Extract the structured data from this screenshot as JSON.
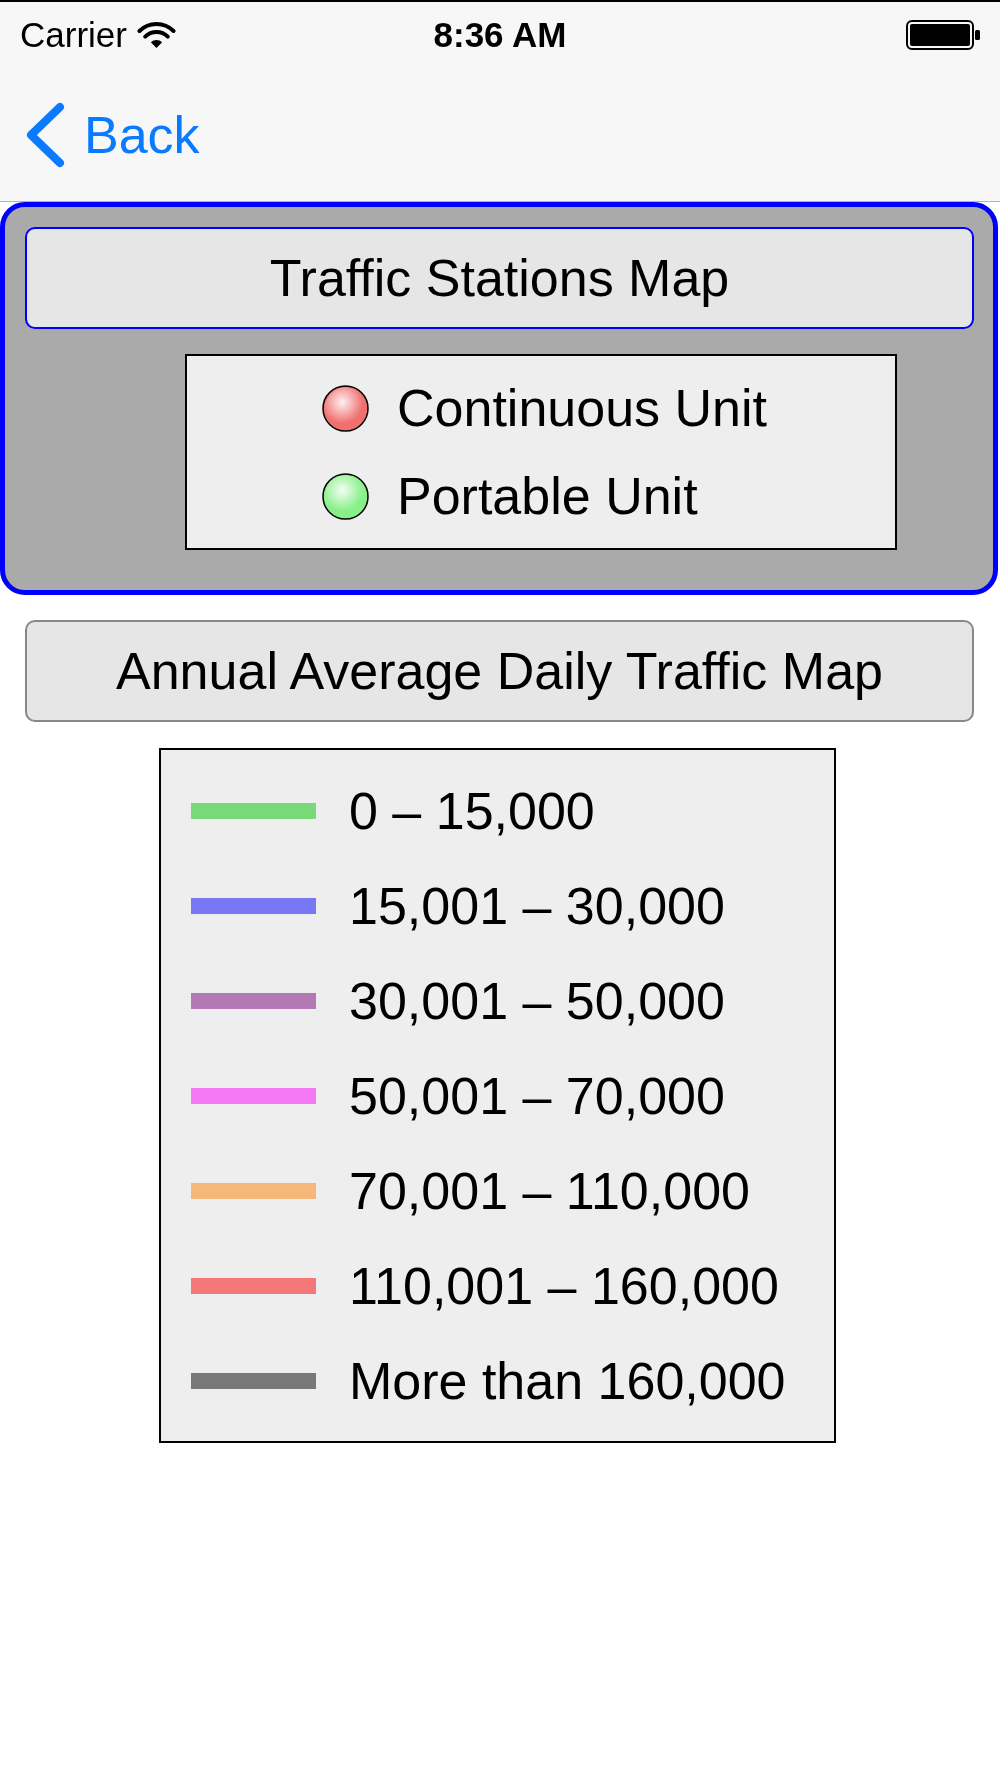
{
  "status_bar": {
    "carrier": "Carrier",
    "time": "8:36 AM"
  },
  "nav_bar": {
    "back": "Back"
  },
  "map_options": [
    {
      "label": "Traffic Stations Map",
      "selected": true,
      "legend": [
        {
          "kind": "dot",
          "label": "Continuous Unit",
          "color": "#f07070"
        },
        {
          "kind": "dot",
          "label": "Portable Unit",
          "color": "#88f088"
        }
      ]
    },
    {
      "label": "Annual Average Daily Traffic Map",
      "selected": false,
      "legend": [
        {
          "kind": "line",
          "label": "0 – 15,000",
          "color": "#78d978"
        },
        {
          "kind": "line",
          "label": "15,001 – 30,000",
          "color": "#7878f5"
        },
        {
          "kind": "line",
          "label": "30,001 – 50,000",
          "color": "#b478b4"
        },
        {
          "kind": "line",
          "label": "50,001 – 70,000",
          "color": "#f578f5"
        },
        {
          "kind": "line",
          "label": "70,001 – 110,000",
          "color": "#f5b878"
        },
        {
          "kind": "line",
          "label": "110,001 – 160,000",
          "color": "#f57878"
        },
        {
          "kind": "line",
          "label": "More than 160,000",
          "color": "#787878"
        }
      ]
    }
  ]
}
